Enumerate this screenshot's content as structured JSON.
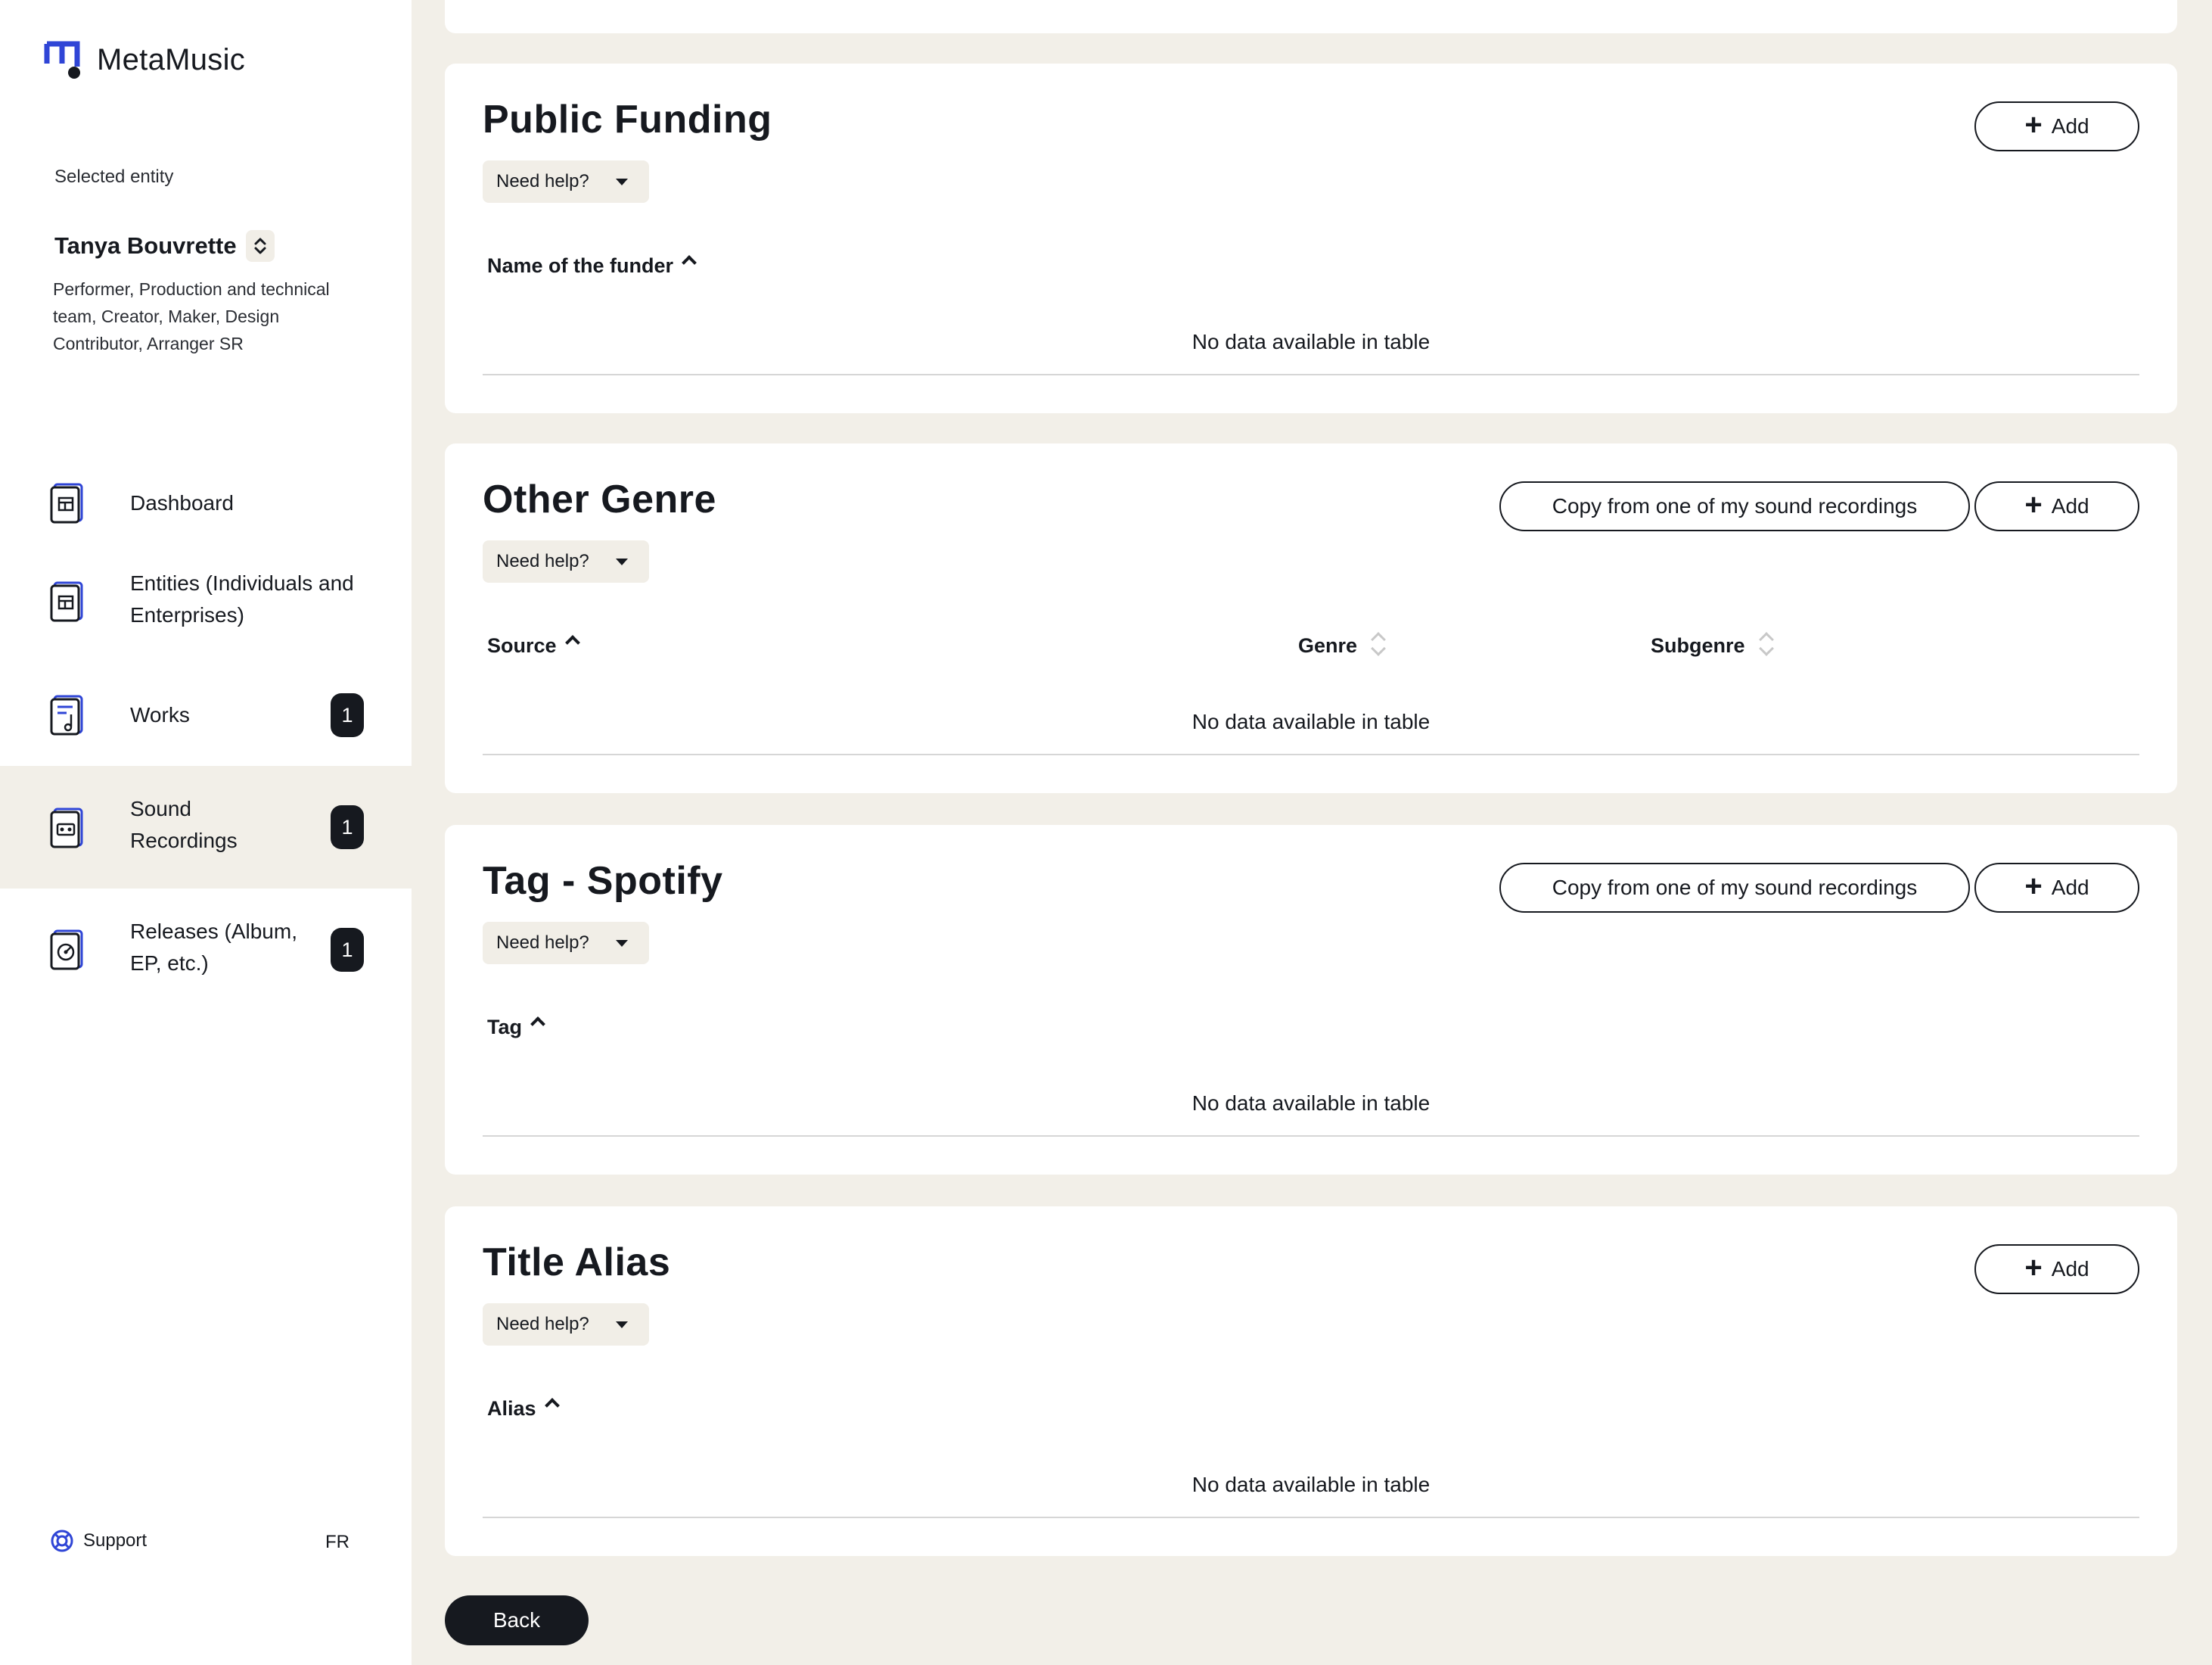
{
  "app": {
    "name": "MetaMusic"
  },
  "sidebar": {
    "selected_label": "Selected entity",
    "entity_name": "Tanya Bouvrette",
    "entity_roles": "Performer, Production and technical team, Creator, Maker, Design Contributor, Arranger SR",
    "items": [
      {
        "label": "Dashboard",
        "icon": "dashboard-icon",
        "badge": null,
        "active": false
      },
      {
        "label": "Entities (Individuals and Enterprises)",
        "icon": "entities-icon",
        "badge": null,
        "active": false
      },
      {
        "label": "Works",
        "icon": "works-icon",
        "badge": "1",
        "active": false
      },
      {
        "label": "Sound Recordings",
        "icon": "sound-recordings-icon",
        "badge": "1",
        "active": true
      },
      {
        "label": "Releases (Album, EP, etc.)",
        "icon": "releases-icon",
        "badge": "1",
        "active": false
      }
    ],
    "support_label": "Support",
    "language": "FR"
  },
  "sections": {
    "public_funding": {
      "title": "Public Funding",
      "help": "Need help?",
      "add": "Add",
      "columns": [
        "Name of the funder"
      ],
      "empty": "No data available in table"
    },
    "other_genre": {
      "title": "Other Genre",
      "help": "Need help?",
      "copy": "Copy from one of my sound recordings",
      "add": "Add",
      "columns": [
        "Source",
        "Genre",
        "Subgenre"
      ],
      "empty": "No data available in table"
    },
    "tag_spotify": {
      "title": "Tag - Spotify",
      "help": "Need help?",
      "copy": "Copy from one of my sound recordings",
      "add": "Add",
      "columns": [
        "Tag"
      ],
      "empty": "No data available in table"
    },
    "title_alias": {
      "title": "Title Alias",
      "help": "Need help?",
      "add": "Add",
      "columns": [
        "Alias"
      ],
      "empty": "No data available in table"
    }
  },
  "back_label": "Back",
  "colors": {
    "accent": "#2f45d6",
    "dark": "#16191f",
    "page_bg": "#f2efe8",
    "help_bg": "#f1eee7"
  }
}
